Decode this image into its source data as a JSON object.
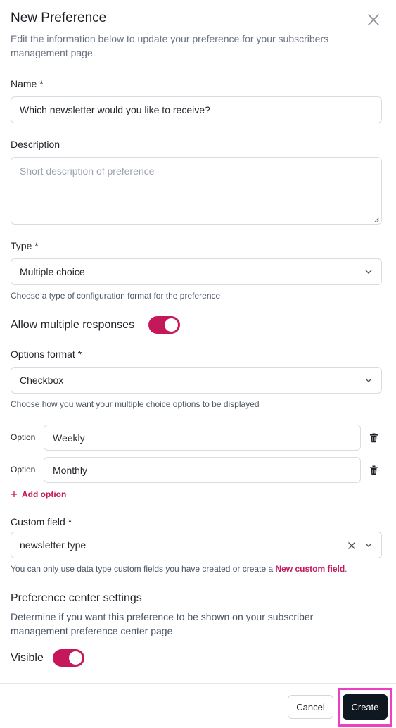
{
  "dialog": {
    "title": "New Preference",
    "subtitle": "Edit the information below to update your preference for your subscribers management page."
  },
  "name": {
    "label": "Name *",
    "value": "Which newsletter would you like to receive?"
  },
  "description": {
    "label": "Description",
    "placeholder": "Short description of preference",
    "value": ""
  },
  "type": {
    "label": "Type *",
    "value": "Multiple choice",
    "help": "Choose a type of configuration format for the preference"
  },
  "allow_multiple": {
    "label": "Allow multiple responses",
    "enabled": true
  },
  "options_format": {
    "label": "Options format *",
    "value": "Checkbox",
    "help": "Choose how you want your multiple choice options to be displayed"
  },
  "options": [
    {
      "label": "Option",
      "value": "Weekly"
    },
    {
      "label": "Option",
      "value": "Monthly"
    }
  ],
  "add_option_label": "Add option",
  "custom_field": {
    "label": "Custom field *",
    "value": "newsletter type",
    "help_prefix": "You can only use data type custom fields you have created or create a",
    "help_link": "New custom field",
    "help_suffix": "."
  },
  "preference_center": {
    "title": "Preference center settings",
    "description": "Determine if you want this preference to be shown on your subscriber management preference center page",
    "visible_label": "Visible",
    "visible_enabled": true
  },
  "footer": {
    "cancel_label": "Cancel",
    "create_label": "Create"
  },
  "colors": {
    "accent": "#c5185a",
    "primary_button": "#0f1721",
    "highlight": "#ee3ec1"
  }
}
